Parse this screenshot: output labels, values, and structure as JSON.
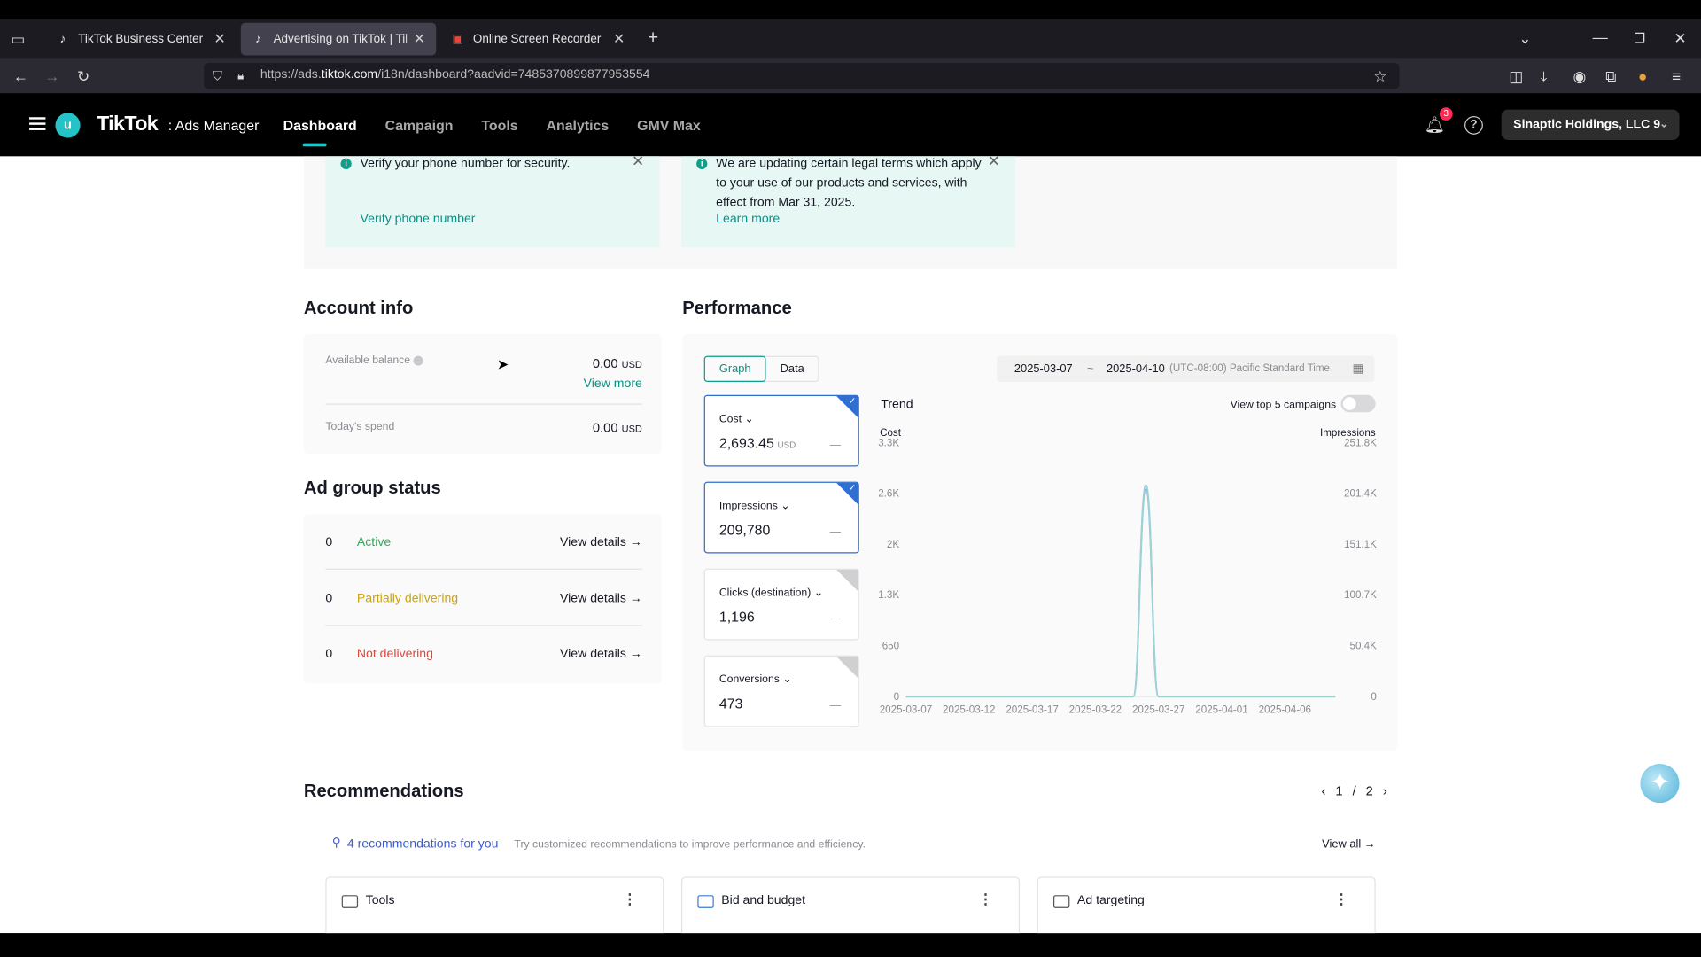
{
  "browser": {
    "tabs": [
      {
        "label": "TikTok Business Center",
        "active": false
      },
      {
        "label": "Advertising on TikTok | TikTok A",
        "active": true
      },
      {
        "label": "Online Screen Recorder",
        "active": false
      }
    ],
    "url_prefix": "https://ads.",
    "url_domain": "tiktok.com",
    "url_path": "/i18n/dashboard?aadvid=7485370899877953554"
  },
  "header": {
    "avatar_letter": "u",
    "logo": "TikTok",
    "logo_sub": ": Ads Manager",
    "nav": [
      "Dashboard",
      "Campaign",
      "Tools",
      "Analytics",
      "GMV Max"
    ],
    "active_nav": "Dashboard",
    "notification_count": "3",
    "account": "Sinaptic Holdings, LLC 9"
  },
  "notices": [
    {
      "text": "Verify your phone number for security.",
      "link": "Verify phone number"
    },
    {
      "text": "We are updating certain legal terms which apply to your use of our products and services, with effect from Mar 31, 2025.",
      "link": "Learn more"
    }
  ],
  "account_info": {
    "title": "Account info",
    "balance_label": "Available balance",
    "balance_value": "0.00",
    "currency": "USD",
    "view_more": "View more",
    "spend_label": "Today's spend",
    "spend_value": "0.00"
  },
  "ad_group_status": {
    "title": "Ad group status",
    "rows": [
      {
        "count": "0",
        "status": "Active",
        "color": "#3aa55d",
        "action": "View details →"
      },
      {
        "count": "0",
        "status": "Partially delivering",
        "color": "#c8a31a",
        "action": "View details →"
      },
      {
        "count": "0",
        "status": "Not delivering",
        "color": "#e0463c",
        "action": "View details →"
      }
    ]
  },
  "performance": {
    "title": "Performance",
    "tabs": [
      "Graph",
      "Data"
    ],
    "active_tab": "Graph",
    "date_start": "2025-03-07",
    "date_sep": "~",
    "date_end": "2025-04-10",
    "timezone": "(UTC-08:00) Pacific Standard Time",
    "metrics": [
      {
        "name": "Cost",
        "value": "2,693.45",
        "unit": "USD",
        "selected": true
      },
      {
        "name": "Impressions",
        "value": "209,780",
        "unit": "",
        "selected": true
      },
      {
        "name": "Clicks (destination)",
        "value": "1,196",
        "unit": "",
        "selected": false
      },
      {
        "name": "Conversions",
        "value": "473",
        "unit": "",
        "selected": false
      }
    ],
    "trend_label": "Trend",
    "top5_label": "View top 5 campaigns",
    "top5_on": false
  },
  "chart_data": {
    "type": "line",
    "title": "Trend",
    "ylabel_left": "Cost",
    "ylabel_right": "Impressions",
    "left_ticks": [
      "0",
      "650",
      "1.3K",
      "2K",
      "2.6K",
      "3.3K"
    ],
    "right_ticks": [
      "0",
      "50.4K",
      "100.7K",
      "151.1K",
      "201.4K",
      "251.8K"
    ],
    "x_ticks": [
      "2025-03-07",
      "2025-03-12",
      "2025-03-17",
      "2025-03-22",
      "2025-03-27",
      "2025-04-01",
      "2025-04-06"
    ],
    "x": [
      "2025-03-07",
      "2025-03-08",
      "2025-03-09",
      "2025-03-10",
      "2025-03-11",
      "2025-03-12",
      "2025-03-13",
      "2025-03-14",
      "2025-03-15",
      "2025-03-16",
      "2025-03-17",
      "2025-03-18",
      "2025-03-19",
      "2025-03-20",
      "2025-03-21",
      "2025-03-22",
      "2025-03-23",
      "2025-03-24",
      "2025-03-25",
      "2025-03-26",
      "2025-03-27",
      "2025-03-28",
      "2025-03-29",
      "2025-03-30",
      "2025-03-31",
      "2025-04-01",
      "2025-04-02",
      "2025-04-03",
      "2025-04-04",
      "2025-04-05",
      "2025-04-06",
      "2025-04-07",
      "2025-04-08",
      "2025-04-09",
      "2025-04-10"
    ],
    "ylim_left": [
      0,
      3300
    ],
    "ylim_right": [
      0,
      251800
    ],
    "series": [
      {
        "name": "Cost",
        "axis": "left",
        "color": "#7cb4e8",
        "values": [
          0,
          0,
          0,
          0,
          0,
          0,
          0,
          0,
          0,
          0,
          0,
          0,
          0,
          0,
          0,
          0,
          0,
          0,
          0,
          2693.45,
          0,
          0,
          0,
          0,
          0,
          0,
          0,
          0,
          0,
          0,
          0,
          0,
          0,
          0,
          0
        ]
      },
      {
        "name": "Impressions",
        "axis": "right",
        "color": "#9fd2d2",
        "values": [
          0,
          0,
          0,
          0,
          0,
          0,
          0,
          0,
          0,
          0,
          0,
          0,
          0,
          0,
          0,
          0,
          0,
          0,
          0,
          209780,
          0,
          0,
          0,
          0,
          0,
          0,
          0,
          0,
          0,
          0,
          0,
          0,
          0,
          0,
          0
        ]
      }
    ],
    "grid": false
  },
  "recommendations": {
    "title": "Recommendations",
    "page_current": "1",
    "page_sep": "/",
    "page_total": "2",
    "count_text": "4 recommendations for you",
    "hint": "Try customized recommendations to improve performance and efficiency.",
    "view_all": "View all →",
    "cards": [
      "Tools",
      "Bid and budget",
      "Ad targeting"
    ]
  }
}
